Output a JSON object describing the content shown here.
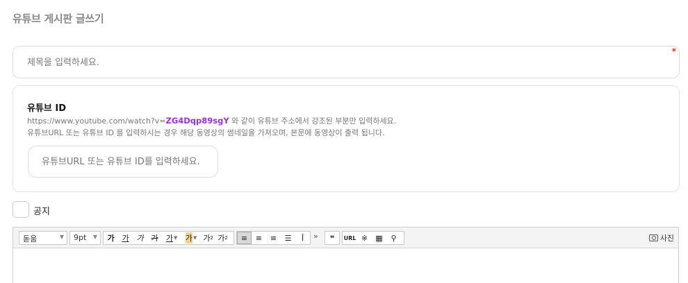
{
  "page": {
    "title": "유튜브 게시판 글쓰기"
  },
  "title_field": {
    "placeholder": "제목을 입력하세요.",
    "required_mark": "*"
  },
  "youtube": {
    "heading": "유튜브 ID",
    "help_url_prefix": "https://www.youtube.com/watch?v=",
    "help_url_id": "ZG4Dqp89sgY",
    "help_url_suffix": " 와 같이 유튜브 주소에서 강조된 부분만 입력하세요.",
    "help_line2": "유튜브URL 또는 유튜브 ID 를 입력하시는 경우 해당 동영상의 썸네일을 가져오며, 본문에 동영상이 출력 됩니다.",
    "input_placeholder": "유튜브URL 또는 유튜브 ID를 입력하세요."
  },
  "notice": {
    "label": "공지",
    "checked": false
  },
  "editor": {
    "font_select": "돋움",
    "size_select": "9pt",
    "format_buttons": [
      "가",
      "가",
      "가",
      "가",
      "가",
      "가",
      "가"
    ],
    "superscript": "가",
    "subscript": "가",
    "more": "»",
    "quote": "❝",
    "url_label": "URL",
    "special_char": "※",
    "photo_label": "사진"
  },
  "colors": {
    "accent": "#9b2fd8",
    "required": "#e0302b",
    "title_gray": "#888888"
  }
}
